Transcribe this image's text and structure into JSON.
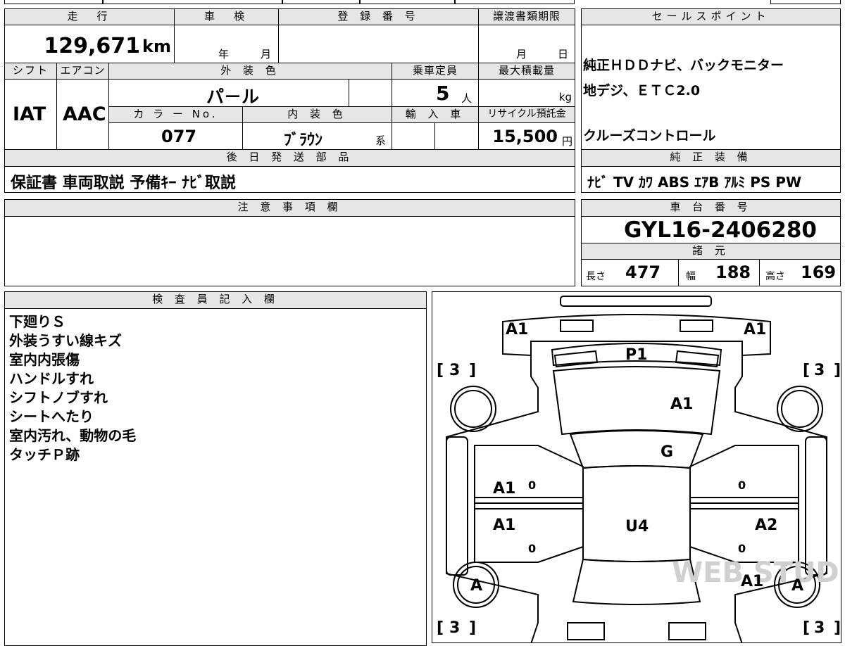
{
  "top": {
    "mileage_header": "走　行",
    "mileage_value": "129,671",
    "mileage_unit": "km",
    "inspection_header": "車　検",
    "inspection_year_label": "年",
    "inspection_month_label": "月",
    "registration_header": "登 録 番 号",
    "transfer_header": "譲渡書類期限",
    "transfer_month_label": "月",
    "transfer_day_label": "日"
  },
  "row2": {
    "shift_header": "シフト",
    "shift_value": "IAT",
    "ac_header": "エアコン",
    "ac_value": "AAC",
    "exterior_header": "外 装 色",
    "exterior_value": "パ－ル",
    "capacity_header": "乗車定員",
    "capacity_value": "5",
    "capacity_unit": "人",
    "max_load_header": "最大積載量",
    "max_load_unit": "kg",
    "color_no_header": "カ ラ ー No.",
    "color_no_value": "077",
    "interior_header": "内 装 色",
    "interior_value": "ﾌﾞﾗｳﾝ",
    "interior_suffix": "系",
    "import_header": "輸 入 車",
    "recycle_header": "リサイクル預託金",
    "recycle_value": "15,500",
    "recycle_unit": "円"
  },
  "later_parts": {
    "header": "後 日 発 送 部 品",
    "value": "保証書 車両取説 予備ｷｰ ﾅﾋﾞ取説"
  },
  "sales_points": {
    "header": "セールスポイント",
    "lines": [
      "純正ＨＤＤナビ、バックモニター",
      "地デジ、ＥＴＣ2.0",
      "",
      "クルーズコントロール"
    ]
  },
  "equipment": {
    "header": "純 正 装 備",
    "value": "ﾅﾋﾞ TV ｶﾜ ABS ｴｱB ｱﾙﾐ PS PW"
  },
  "notes": {
    "header": "注 意 事 項 欄"
  },
  "chassis": {
    "header": "車 台 番 号",
    "value": "GYL16-2406280"
  },
  "specs": {
    "header": "諸 元",
    "length_label": "長さ",
    "length_value": "477",
    "width_label": "幅",
    "width_value": "188",
    "height_label": "高さ",
    "height_value": "169"
  },
  "inspector": {
    "header": "検 査 員 記 入 欄",
    "lines": [
      "下廻りＳ",
      "外装うすい線キズ",
      "室内内張傷",
      "ハンドルすれ",
      "シフトノブすれ",
      "シートへたり",
      "室内汚れ、動物の毛",
      "タッチＰ跡"
    ]
  },
  "diagram": {
    "marks": {
      "front_left": "A1",
      "front_right": "A1",
      "front_bumper": "P1",
      "hood": "A1",
      "windshield": "G",
      "front_door_left": "A1",
      "rear_door_left": "A1",
      "roof": "U4",
      "rear_door_right": "A2",
      "rear_quarter_right": "A1",
      "tire_front_left": "3",
      "tire_front_right": "3",
      "tire_rear_left": "3",
      "tire_rear_right": "3",
      "wheel_rear_left": "A",
      "wheel_rear_right": "A",
      "pillar_fl": "0",
      "pillar_rl": "0",
      "pillar_fr": "0",
      "pillar_rr": "0"
    },
    "watermark": "WEB STUDIO"
  }
}
